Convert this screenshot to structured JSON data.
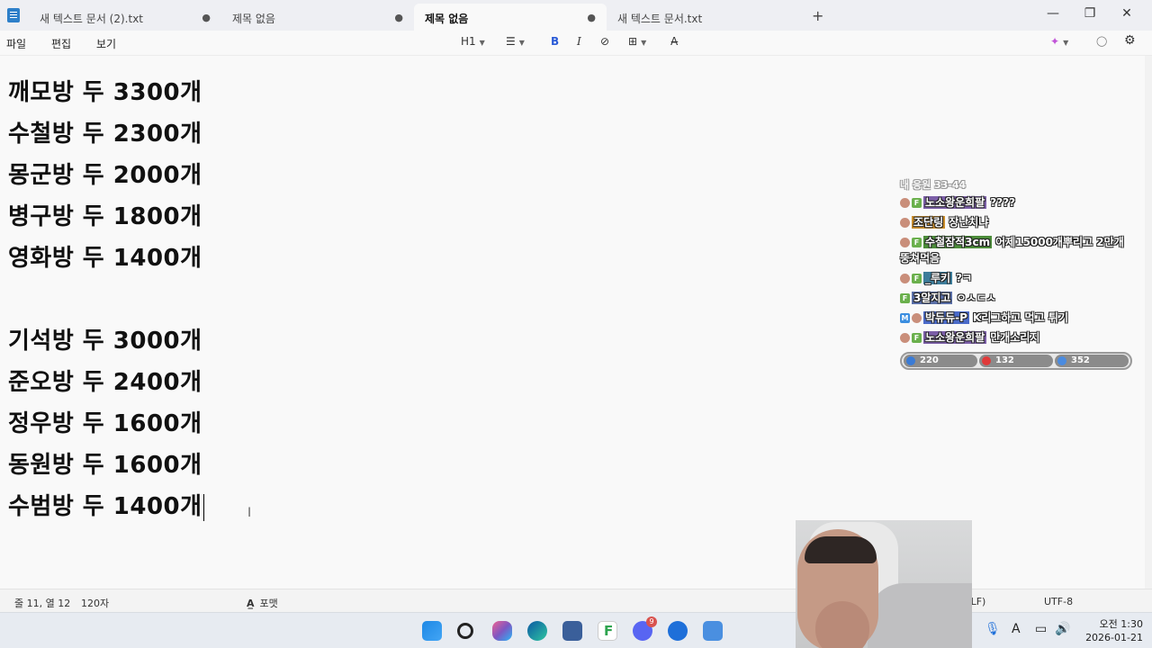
{
  "window": {
    "tabs": [
      {
        "label": "새 텍스트 문서 (2).txt",
        "dot": "●"
      },
      {
        "label": "제목 없음",
        "dot": "●"
      },
      {
        "label": "제목 없음",
        "dot": "●"
      },
      {
        "label": "새 텍스트 문서.txt",
        "dot": ""
      }
    ],
    "new_tab": "+",
    "minimize": "—",
    "maximize": "❐",
    "close": "✕"
  },
  "menu": {
    "file": "파일",
    "edit": "편집",
    "view": "보기",
    "heading": "H1",
    "list": "☰",
    "bold": "B",
    "italic": "I",
    "link": "⊘",
    "table": "⊞",
    "clear": "A̶",
    "copilot": "✦",
    "account": "◯",
    "settings": "⚙"
  },
  "document": {
    "lines": [
      "깨모방 두 3300개",
      "수철방 두 2300개",
      "몽군방 두 2000개",
      "병구방 두 1800개",
      "영화방 두 1400개",
      "기석방 두 3000개",
      "준오방 두 2400개",
      "정우방 두 1600개",
      "동원방 두 1600개",
      "수범방 두 1400개"
    ],
    "ibeam": "I"
  },
  "chat": {
    "header": "내 응원 33-44",
    "messages": [
      {
        "user": "노소왕운희팔",
        "text": "????",
        "user_bg": "#7b5ea7",
        "badges": [
          "face",
          "green"
        ]
      },
      {
        "user": "조단링",
        "text": "장난치냐",
        "user_bg": "#c98c2a",
        "badges": [
          "face"
        ]
      },
      {
        "user": "수철잠적3cm",
        "text": "어제15000개뿌리고 2만개 뚱쳐먹음",
        "user_bg": "#4c8c3a",
        "badges": [
          "face",
          "green"
        ]
      },
      {
        "user": "_루키",
        "text": "?ㅋ",
        "user_bg": "#3c7c9a",
        "badges": [
          "face",
          "green"
        ]
      },
      {
        "user": "3알지고",
        "text": "ㅇㅅㄷㅅ",
        "user_bg": "#5a6fa8",
        "badges": [
          "green"
        ]
      },
      {
        "user": "박듀듀-P",
        "text": "K리그하고 먹고 튀기",
        "user_bg": "#4a6ac8",
        "badges": [
          "blue",
          "face"
        ]
      },
      {
        "user": "노소왕운희팔",
        "text": "만개소리지",
        "user_bg": "#7b5ea7",
        "badges": [
          "face",
          "green"
        ]
      }
    ],
    "stats": [
      {
        "value": "220",
        "color": "#3a7bd5"
      },
      {
        "value": "132",
        "color": "#e03a3a"
      },
      {
        "value": "352",
        "color": "#4a8be0"
      }
    ]
  },
  "status": {
    "position": "줄 11, 열 12",
    "chars": "120자",
    "format": "포맷",
    "eol": "ows (CRLF)",
    "encoding": "UTF-8"
  },
  "taskbar": {
    "discord_badge": "9",
    "tray": {
      "chevron": "^",
      "mic": "🎙",
      "lang": "A",
      "network": "▭",
      "volume": "🔊"
    },
    "time": "오전 1:30",
    "date": "2026-01-21"
  }
}
